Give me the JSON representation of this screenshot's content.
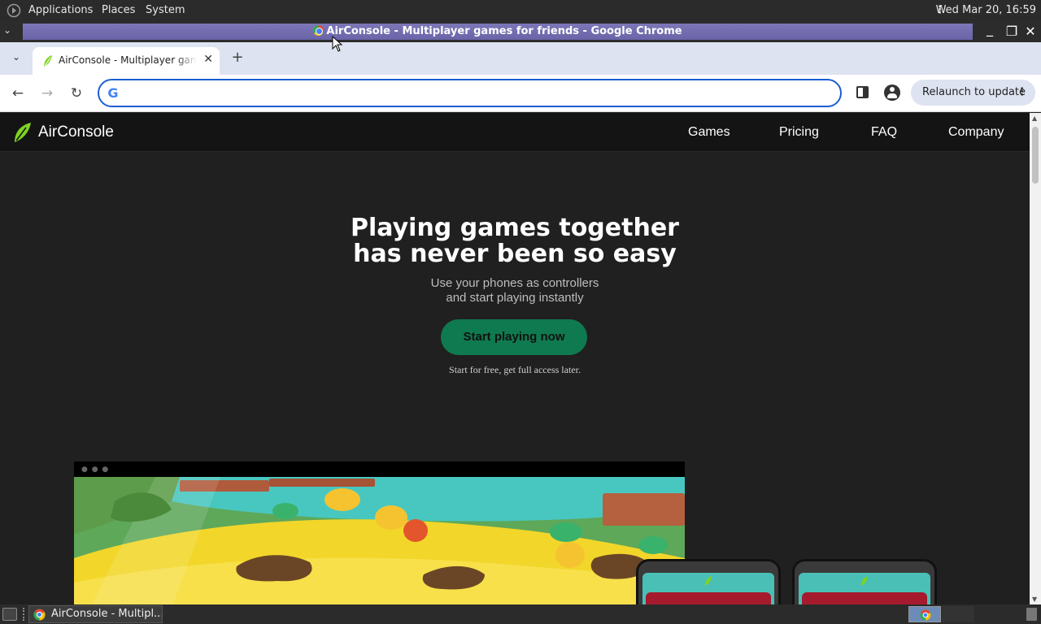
{
  "top_panel": {
    "menus": [
      "Applications",
      "Places",
      "System"
    ],
    "clock": "Wed Mar 20, 16:59"
  },
  "window": {
    "title": "AirConsole - Multiplayer games for friends - Google Chrome"
  },
  "browser": {
    "tab": {
      "title": "AirConsole - Multiplayer games for friends"
    },
    "omnibox": {
      "value": "",
      "placeholder": ""
    },
    "relaunch_label": "Relaunch to update"
  },
  "site": {
    "brand": "AirConsole",
    "nav": [
      "Games",
      "Pricing",
      "FAQ",
      "Company"
    ],
    "hero": {
      "title_line1": "Playing games together",
      "title_line2": "has never been so easy",
      "sub_line1": "Use your phones as controllers",
      "sub_line2": "and start playing instantly",
      "cta": "Start playing now",
      "cta_note": "Start for free, get full access later."
    }
  },
  "taskbar": {
    "task_label": "AirConsole - Multipl..."
  },
  "colors": {
    "accent": "#1a5fd0",
    "cta": "#0f7a4f",
    "brand_green": "#7ed321",
    "titlebar": "#6a64a8"
  },
  "icons": [
    "gnome-foot-icon",
    "chrome-icon",
    "airconsole-leaf-icon",
    "back-arrow-icon",
    "forward-arrow-icon",
    "reload-icon",
    "google-g-icon",
    "side-panel-icon",
    "profile-icon",
    "kebab-menu-icon",
    "close-icon",
    "plus-icon",
    "chevron-down-icon"
  ]
}
